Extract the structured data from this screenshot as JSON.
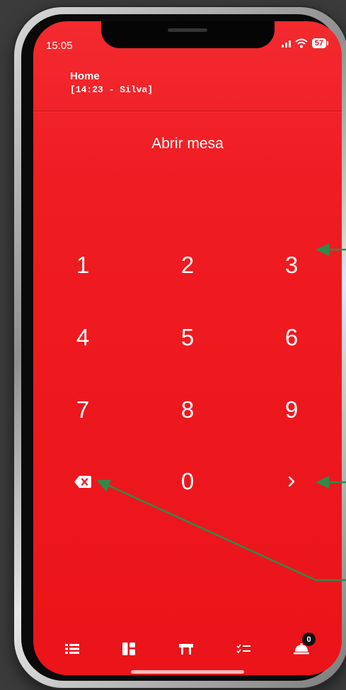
{
  "status_bar": {
    "time": "15:05",
    "battery": "57"
  },
  "header": {
    "title": "Home",
    "subtitle": "[14:23 - Silva]"
  },
  "page_title": "Abrir mesa",
  "keypad": {
    "keys": [
      "1",
      "2",
      "3",
      "4",
      "5",
      "6",
      "7",
      "8",
      "9",
      "0"
    ]
  },
  "bottom_nav": {
    "badge_count": "0"
  },
  "colors": {
    "screen_background": "#ef1c22",
    "annotation_arrow": "#2f8a4a",
    "text": "#ffffff"
  },
  "icons": [
    "backspace-icon",
    "chevron-right-icon",
    "list-icon",
    "dashboard-icon",
    "table-icon",
    "checklist-icon",
    "service-bell-icon"
  ]
}
